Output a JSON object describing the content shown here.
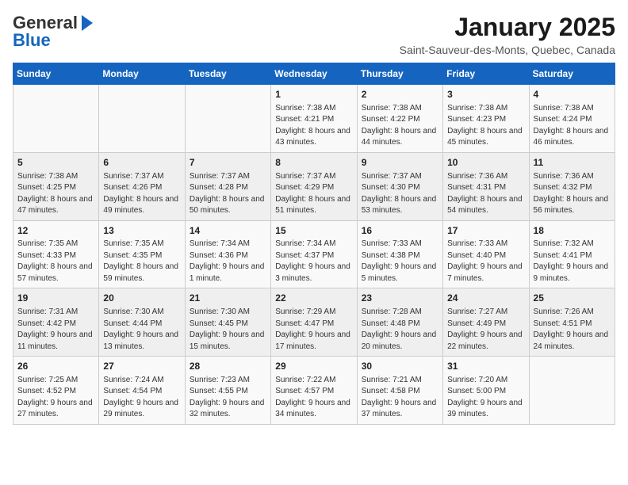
{
  "header": {
    "logo_general": "General",
    "logo_blue": "Blue",
    "month_title": "January 2025",
    "location": "Saint-Sauveur-des-Monts, Quebec, Canada"
  },
  "days_of_week": [
    "Sunday",
    "Monday",
    "Tuesday",
    "Wednesday",
    "Thursday",
    "Friday",
    "Saturday"
  ],
  "weeks": [
    [
      {
        "day": "",
        "info": ""
      },
      {
        "day": "",
        "info": ""
      },
      {
        "day": "",
        "info": ""
      },
      {
        "day": "1",
        "info": "Sunrise: 7:38 AM\nSunset: 4:21 PM\nDaylight: 8 hours and 43 minutes."
      },
      {
        "day": "2",
        "info": "Sunrise: 7:38 AM\nSunset: 4:22 PM\nDaylight: 8 hours and 44 minutes."
      },
      {
        "day": "3",
        "info": "Sunrise: 7:38 AM\nSunset: 4:23 PM\nDaylight: 8 hours and 45 minutes."
      },
      {
        "day": "4",
        "info": "Sunrise: 7:38 AM\nSunset: 4:24 PM\nDaylight: 8 hours and 46 minutes."
      }
    ],
    [
      {
        "day": "5",
        "info": "Sunrise: 7:38 AM\nSunset: 4:25 PM\nDaylight: 8 hours and 47 minutes."
      },
      {
        "day": "6",
        "info": "Sunrise: 7:37 AM\nSunset: 4:26 PM\nDaylight: 8 hours and 49 minutes."
      },
      {
        "day": "7",
        "info": "Sunrise: 7:37 AM\nSunset: 4:28 PM\nDaylight: 8 hours and 50 minutes."
      },
      {
        "day": "8",
        "info": "Sunrise: 7:37 AM\nSunset: 4:29 PM\nDaylight: 8 hours and 51 minutes."
      },
      {
        "day": "9",
        "info": "Sunrise: 7:37 AM\nSunset: 4:30 PM\nDaylight: 8 hours and 53 minutes."
      },
      {
        "day": "10",
        "info": "Sunrise: 7:36 AM\nSunset: 4:31 PM\nDaylight: 8 hours and 54 minutes."
      },
      {
        "day": "11",
        "info": "Sunrise: 7:36 AM\nSunset: 4:32 PM\nDaylight: 8 hours and 56 minutes."
      }
    ],
    [
      {
        "day": "12",
        "info": "Sunrise: 7:35 AM\nSunset: 4:33 PM\nDaylight: 8 hours and 57 minutes."
      },
      {
        "day": "13",
        "info": "Sunrise: 7:35 AM\nSunset: 4:35 PM\nDaylight: 8 hours and 59 minutes."
      },
      {
        "day": "14",
        "info": "Sunrise: 7:34 AM\nSunset: 4:36 PM\nDaylight: 9 hours and 1 minute."
      },
      {
        "day": "15",
        "info": "Sunrise: 7:34 AM\nSunset: 4:37 PM\nDaylight: 9 hours and 3 minutes."
      },
      {
        "day": "16",
        "info": "Sunrise: 7:33 AM\nSunset: 4:38 PM\nDaylight: 9 hours and 5 minutes."
      },
      {
        "day": "17",
        "info": "Sunrise: 7:33 AM\nSunset: 4:40 PM\nDaylight: 9 hours and 7 minutes."
      },
      {
        "day": "18",
        "info": "Sunrise: 7:32 AM\nSunset: 4:41 PM\nDaylight: 9 hours and 9 minutes."
      }
    ],
    [
      {
        "day": "19",
        "info": "Sunrise: 7:31 AM\nSunset: 4:42 PM\nDaylight: 9 hours and 11 minutes."
      },
      {
        "day": "20",
        "info": "Sunrise: 7:30 AM\nSunset: 4:44 PM\nDaylight: 9 hours and 13 minutes."
      },
      {
        "day": "21",
        "info": "Sunrise: 7:30 AM\nSunset: 4:45 PM\nDaylight: 9 hours and 15 minutes."
      },
      {
        "day": "22",
        "info": "Sunrise: 7:29 AM\nSunset: 4:47 PM\nDaylight: 9 hours and 17 minutes."
      },
      {
        "day": "23",
        "info": "Sunrise: 7:28 AM\nSunset: 4:48 PM\nDaylight: 9 hours and 20 minutes."
      },
      {
        "day": "24",
        "info": "Sunrise: 7:27 AM\nSunset: 4:49 PM\nDaylight: 9 hours and 22 minutes."
      },
      {
        "day": "25",
        "info": "Sunrise: 7:26 AM\nSunset: 4:51 PM\nDaylight: 9 hours and 24 minutes."
      }
    ],
    [
      {
        "day": "26",
        "info": "Sunrise: 7:25 AM\nSunset: 4:52 PM\nDaylight: 9 hours and 27 minutes."
      },
      {
        "day": "27",
        "info": "Sunrise: 7:24 AM\nSunset: 4:54 PM\nDaylight: 9 hours and 29 minutes."
      },
      {
        "day": "28",
        "info": "Sunrise: 7:23 AM\nSunset: 4:55 PM\nDaylight: 9 hours and 32 minutes."
      },
      {
        "day": "29",
        "info": "Sunrise: 7:22 AM\nSunset: 4:57 PM\nDaylight: 9 hours and 34 minutes."
      },
      {
        "day": "30",
        "info": "Sunrise: 7:21 AM\nSunset: 4:58 PM\nDaylight: 9 hours and 37 minutes."
      },
      {
        "day": "31",
        "info": "Sunrise: 7:20 AM\nSunset: 5:00 PM\nDaylight: 9 hours and 39 minutes."
      },
      {
        "day": "",
        "info": ""
      }
    ]
  ]
}
